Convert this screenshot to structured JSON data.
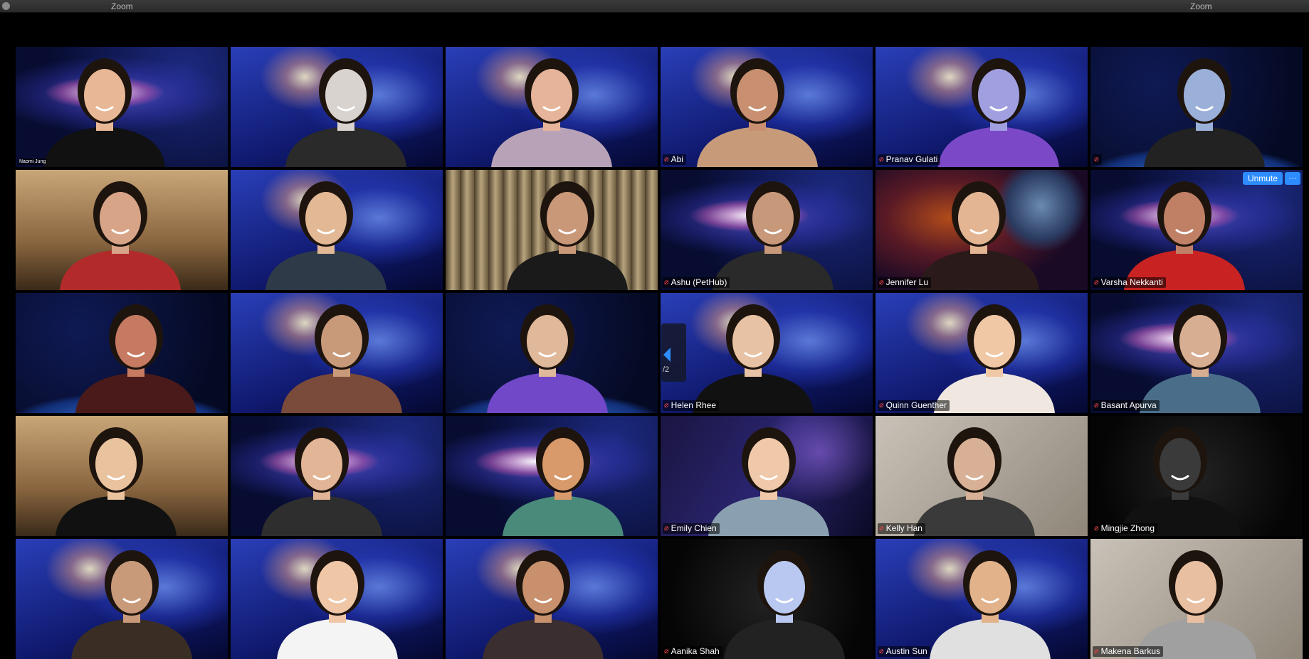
{
  "window": {
    "title_left": "Zoom",
    "title_right": "Zoom"
  },
  "page_nav": {
    "page": "/2"
  },
  "hover_controls": {
    "unmute_label": "Unmute",
    "more_label": "···"
  },
  "colors": {
    "accent": "#2d8cff",
    "active_speaker_border": "#e8e67a",
    "muted_icon": "#e64545"
  },
  "tiles": [
    {
      "name": "Naomi Jung",
      "muted": false,
      "active": true
    },
    {
      "name": "",
      "muted": false
    },
    {
      "name": "",
      "muted": false
    },
    {
      "name": "Abi",
      "muted": true
    },
    {
      "name": "Pranav Gulati",
      "muted": true
    },
    {
      "name": "",
      "muted": true
    },
    {
      "name": "",
      "muted": false
    },
    {
      "name": "",
      "muted": false
    },
    {
      "name": "",
      "muted": false
    },
    {
      "name": "Ashu (PetHub)",
      "muted": true
    },
    {
      "name": "Jennifer Lu",
      "muted": true
    },
    {
      "name": "Varsha Nekkanti",
      "muted": true
    },
    {
      "name": "",
      "muted": false
    },
    {
      "name": "",
      "muted": false
    },
    {
      "name": "",
      "muted": false
    },
    {
      "name": "Helen Rhee",
      "muted": true
    },
    {
      "name": "Quinn Guenther",
      "muted": true
    },
    {
      "name": "Basant Apurva",
      "muted": true
    },
    {
      "name": "",
      "muted": false
    },
    {
      "name": "",
      "muted": false
    },
    {
      "name": "",
      "muted": false
    },
    {
      "name": "Emily Chien",
      "muted": true
    },
    {
      "name": "Kelly Han",
      "muted": true
    },
    {
      "name": "Mingjie Zhong",
      "muted": true
    },
    {
      "name": "",
      "muted": false
    },
    {
      "name": "",
      "muted": false
    },
    {
      "name": "",
      "muted": false
    },
    {
      "name": "Aanika Shah",
      "muted": true
    },
    {
      "name": "Austin Sun",
      "muted": true
    },
    {
      "name": "Makena Barkus",
      "muted": true
    }
  ],
  "icons": {
    "muted": "mic-muted-icon",
    "close": "close-dot-icon",
    "page_prev": "chevron-left-icon"
  }
}
